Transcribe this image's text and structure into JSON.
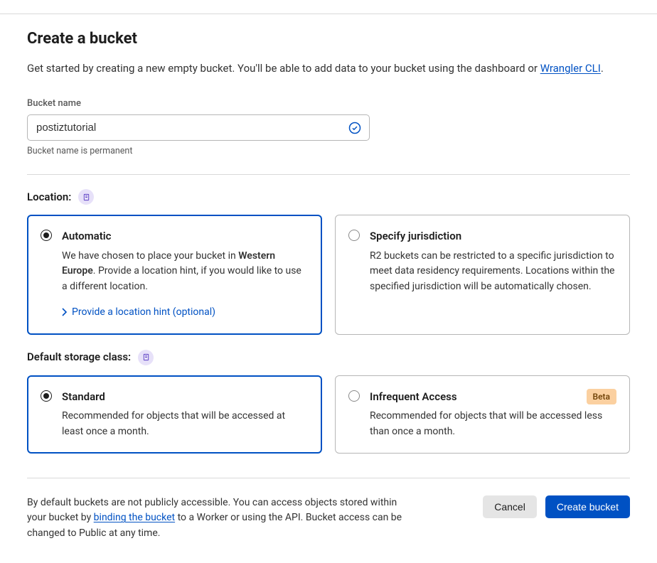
{
  "page": {
    "title": "Create a bucket",
    "intro_prefix": "Get started by creating a new empty bucket. You'll be able to add data to your bucket using the dashboard or ",
    "intro_link": "Wrangler CLI",
    "intro_suffix": "."
  },
  "bucket_name": {
    "label": "Bucket name",
    "value": "postiztutorial",
    "helper": "Bucket name is permanent"
  },
  "location": {
    "label": "Location:",
    "options": {
      "automatic": {
        "title": "Automatic",
        "desc_prefix": "We have chosen to place your bucket in ",
        "desc_bold": "Western Europe",
        "desc_suffix": ". Provide a location hint, if you would like to use a different location.",
        "hint_link": "Provide a location hint (optional)"
      },
      "jurisdiction": {
        "title": "Specify jurisdiction",
        "desc": "R2 buckets can be restricted to a specific jurisdiction to meet data residency requirements. Locations within the specified jurisdiction will be automatically chosen."
      }
    }
  },
  "storage_class": {
    "label": "Default storage class:",
    "options": {
      "standard": {
        "title": "Standard",
        "desc": "Recommended for objects that will be accessed at least once a month."
      },
      "infrequent": {
        "title": "Infrequent Access",
        "badge": "Beta",
        "desc": "Recommended for objects that will be accessed less than once a month."
      }
    }
  },
  "footer": {
    "text_prefix": "By default buckets are not publicly accessible. You can access objects stored within your bucket by ",
    "text_link": "binding the bucket",
    "text_suffix": " to a Worker or using the API. Bucket access can be changed to Public at any time.",
    "cancel": "Cancel",
    "create": "Create bucket"
  }
}
